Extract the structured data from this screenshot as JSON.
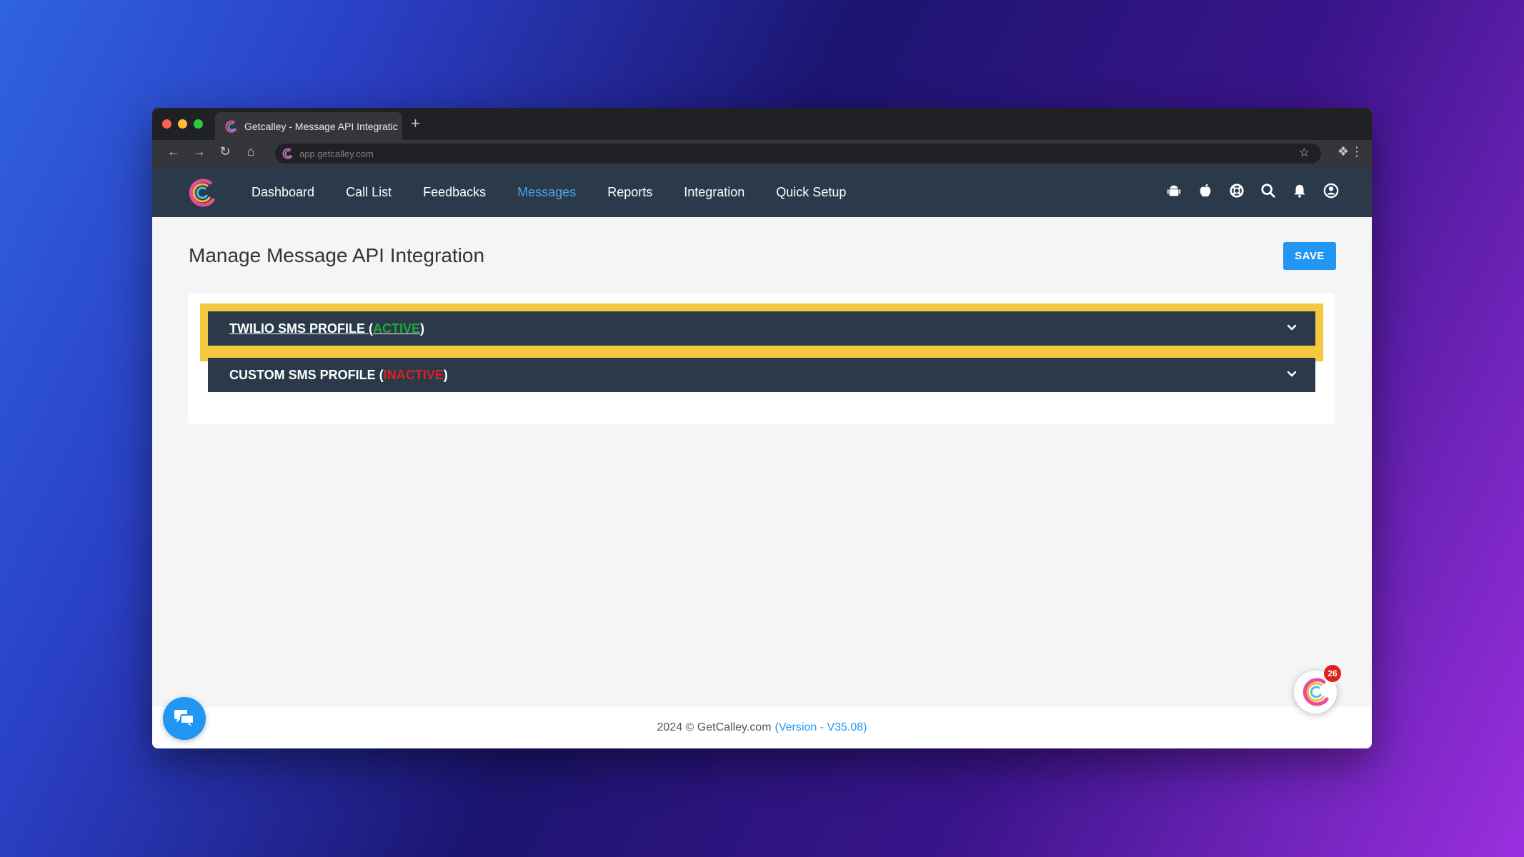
{
  "browser": {
    "tab_title": "Getcalley - Message API Integratic",
    "new_tab": "+",
    "url": "app.getcalley.com"
  },
  "nav": {
    "items": [
      {
        "label": "Dashboard"
      },
      {
        "label": "Call List"
      },
      {
        "label": "Feedbacks"
      },
      {
        "label": "Messages"
      },
      {
        "label": "Reports"
      },
      {
        "label": "Integration"
      },
      {
        "label": "Quick Setup"
      }
    ],
    "active": "Messages",
    "icons": [
      "android-icon",
      "apple-icon",
      "help-lifebuoy-icon",
      "search-icon",
      "bell-icon",
      "user-icon"
    ]
  },
  "page": {
    "title": "Manage Message API Integration",
    "save_label": "SAVE"
  },
  "profiles": [
    {
      "name": "TWILIO SMS PROFILE",
      "open": "(",
      "status": "ACTIVE",
      "close": ")"
    },
    {
      "name": "CUSTOM SMS PROFILE",
      "open": "(",
      "status": "INACTIVE",
      "close": ")"
    }
  ],
  "footer": {
    "copyright": "2024 © GetCalley.com",
    "version": "(Version - V35.08)"
  },
  "badge": {
    "count": "26"
  },
  "colors": {
    "nav_bg": "#2b3a4a",
    "accent": "#2196f3",
    "active_status": "#1fa83a",
    "inactive_status": "#e0201e",
    "highlight": "#f5c842"
  }
}
